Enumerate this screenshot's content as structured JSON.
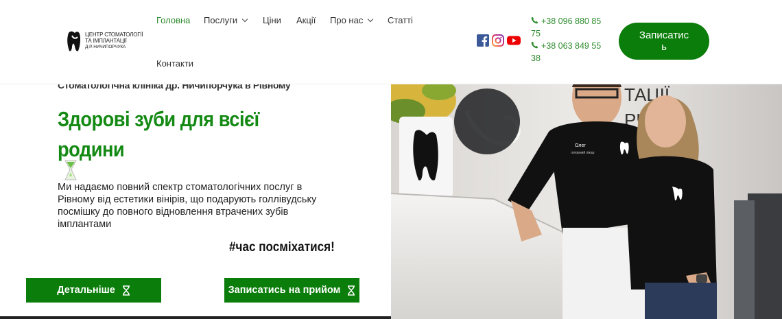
{
  "logo": {
    "line1": "ЦЕНТР СТОМАТОЛОГІЇ",
    "line2": "ТА ІМПЛАНТАЦІЇ",
    "line3": "Д-Р. НИЧИПОРЧУКА"
  },
  "nav": {
    "items": [
      {
        "label": "Головна",
        "active": true
      },
      {
        "label": "Послуги",
        "dropdown": true
      },
      {
        "label": "Ціни"
      },
      {
        "label": "Акції"
      },
      {
        "label": "Про нас",
        "dropdown": true
      },
      {
        "label": "Статті"
      },
      {
        "label": "Контакти"
      }
    ]
  },
  "social": [
    "facebook-icon",
    "instagram-icon",
    "youtube-icon"
  ],
  "phones": {
    "phone1_a": "+38 096 880 85",
    "phone1_b": "75",
    "phone2_a": "+38 063 849 55",
    "phone2_b": "38"
  },
  "header": {
    "book_label_a": "Записатис",
    "book_label_b": "ь"
  },
  "hero": {
    "clinic_line": "Стоматологічна клініка др. Ничипорчука в Рівному",
    "title_line1": "Здорові зуби для всієї",
    "title_line2": "родини",
    "description": "Ми надаємо повний спектр стоматологічних послуг в Рівному від естетики вінірів, що подарують голлівудську посмішку до повного відновлення втрачених зубів імплантами",
    "hashtag": "#час посміхатися!",
    "cta_details": "Детальніше",
    "cta_book": "Записатись на прийом"
  },
  "photo": {
    "badge_name": "Олег",
    "badge_role": "головний лікар",
    "wall_text_1": "ТАЦІЇ",
    "wall_text_2": "РЧУКА"
  },
  "colors": {
    "brand_green": "#0a7d0a",
    "title_green": "#148a14",
    "link_green": "#2e8b2e"
  }
}
